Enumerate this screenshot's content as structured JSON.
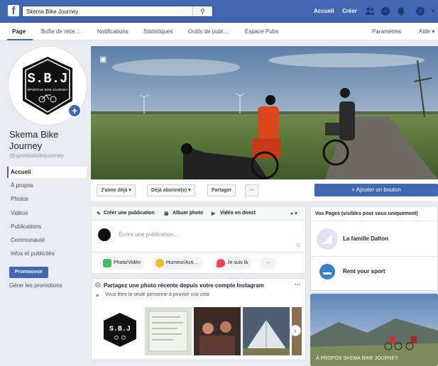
{
  "topbar": {
    "logo": "f",
    "search_value": "Skema Bike Journey",
    "home": "Accueil",
    "create": "Créer"
  },
  "page_nav": {
    "items": [
      "Page",
      "Boîte de réce…",
      "Notifications",
      "Statistiques",
      "Outils de publ…",
      "Espace Pubs"
    ],
    "settings": "Paramètres",
    "help": "Aide ▾"
  },
  "profile": {
    "logo_text": "S.B.J",
    "logo_sub": "SPORTIVE BIKE JOURNEY",
    "name": "Skema Bike Journey",
    "handle": "@sportivebikejourney"
  },
  "left_nav": [
    "Accueil",
    "À propos",
    "Photos",
    "Vidéos",
    "Publications",
    "Communauté",
    "Infos et publicités"
  ],
  "promote": {
    "button": "Promouvoir",
    "manage": "Gérer les promotions"
  },
  "actions": {
    "like": "J'aime déjà ▾",
    "follow": "Déjà abonné(e) ▾",
    "share": "Partager",
    "more": "···",
    "add_button": "+ Ajouter un bouton"
  },
  "composer": {
    "tab_create": "Créer une publication",
    "tab_album": "Album photo",
    "tab_live": "Vidéo en direct",
    "placeholder": "Écrire une publication…",
    "chips": [
      {
        "label": "Photo/Vidéo",
        "color": "#45bd62"
      },
      {
        "label": "Humeur/Acti…",
        "color": "#f7b928"
      },
      {
        "label": "Je suis là",
        "color": "#f3425f"
      }
    ],
    "chip_more": "···"
  },
  "instagram": {
    "title": "Partagez une photo récente depuis votre compte Instagram",
    "note": "Vous êtes la seule personne à pouvoir voir cela",
    "more": "···"
  },
  "right": {
    "title": "Vos Pages (visibles pour vous uniquement)",
    "pages": [
      "La famille Dalton",
      "Rent your sport"
    ],
    "about_caption": "À PROPOS SKEMA BIKE JOURNEY"
  },
  "colors": {
    "brand": "#4267b2",
    "link": "#365899",
    "bg": "#e9ebee"
  }
}
